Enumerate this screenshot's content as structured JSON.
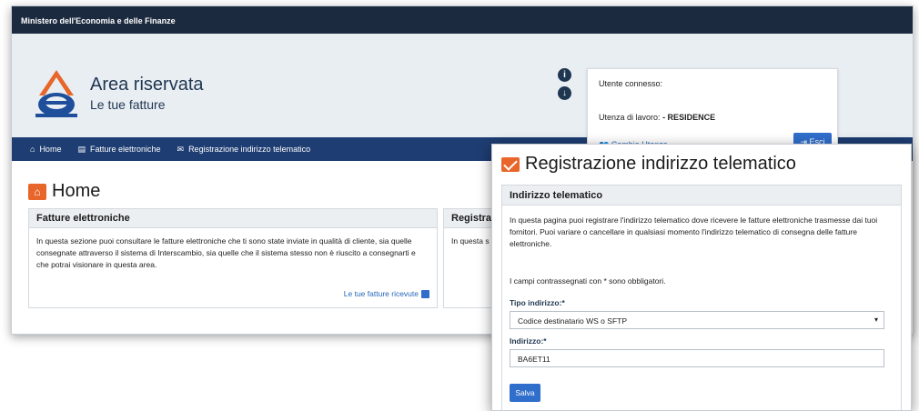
{
  "ministry_bar": {
    "text": "Ministero dell'Economia e delle Finanze"
  },
  "header": {
    "title": "Area riservata",
    "subtitle": "Le tue fatture",
    "info_icon": "info-icon",
    "download_icon": "download-icon"
  },
  "user_box": {
    "connected_label": "Utente connesso:",
    "workspace_label": "Utenza di lavoro:",
    "workspace_value": "- RESIDENCE",
    "change_user": "Cambia Utenza",
    "exit": "Esci"
  },
  "nav": {
    "items": [
      {
        "label": "Home",
        "icon": "home-icon"
      },
      {
        "label": "Fatture elettroniche",
        "icon": "invoice-icon"
      },
      {
        "label": "Registrazione indirizzo telematico",
        "icon": "mail-icon"
      }
    ]
  },
  "home": {
    "title": "Home",
    "card1": {
      "title": "Fatture elettroniche",
      "body": "In questa sezione puoi consultare le fatture elettroniche che ti sono state inviate in qualità di cliente, sia quelle consegnate attraverso il sistema di Interscambio, sia quelle che il sistema stesso non è riuscito a consegnarti e che potrai visionare in questa area.",
      "link": "Le tue fatture ricevute"
    },
    "card2": {
      "title": "Registra",
      "body": "In questa s"
    }
  },
  "dialog": {
    "title": "Registrazione indirizzo telematico",
    "section_title": "Indirizzo telematico",
    "description": "In questa pagina puoi registrare l'indirizzo telematico dove ricevere le fatture elettroniche trasmesse dai tuoi fornitori. Puoi variare o cancellare in qualsiasi momento l'indirizzo telematico di consegna delle fatture elettroniche.",
    "required_note": "I campi contrassegnati con * sono obbligatori.",
    "type_label": "Tipo indirizzo:*",
    "type_value": "Codice destinatario WS o SFTP",
    "address_label": "Indirizzo:*",
    "address_value": "BA6ET11",
    "save": "Salva"
  },
  "colors": {
    "ministry_bar": "#1c2a3f",
    "navbar": "#1e3d72",
    "header_bg": "#e9eef3",
    "accent_orange": "#e8662a",
    "button_blue": "#2f6ecb",
    "link_blue": "#2466b8"
  }
}
